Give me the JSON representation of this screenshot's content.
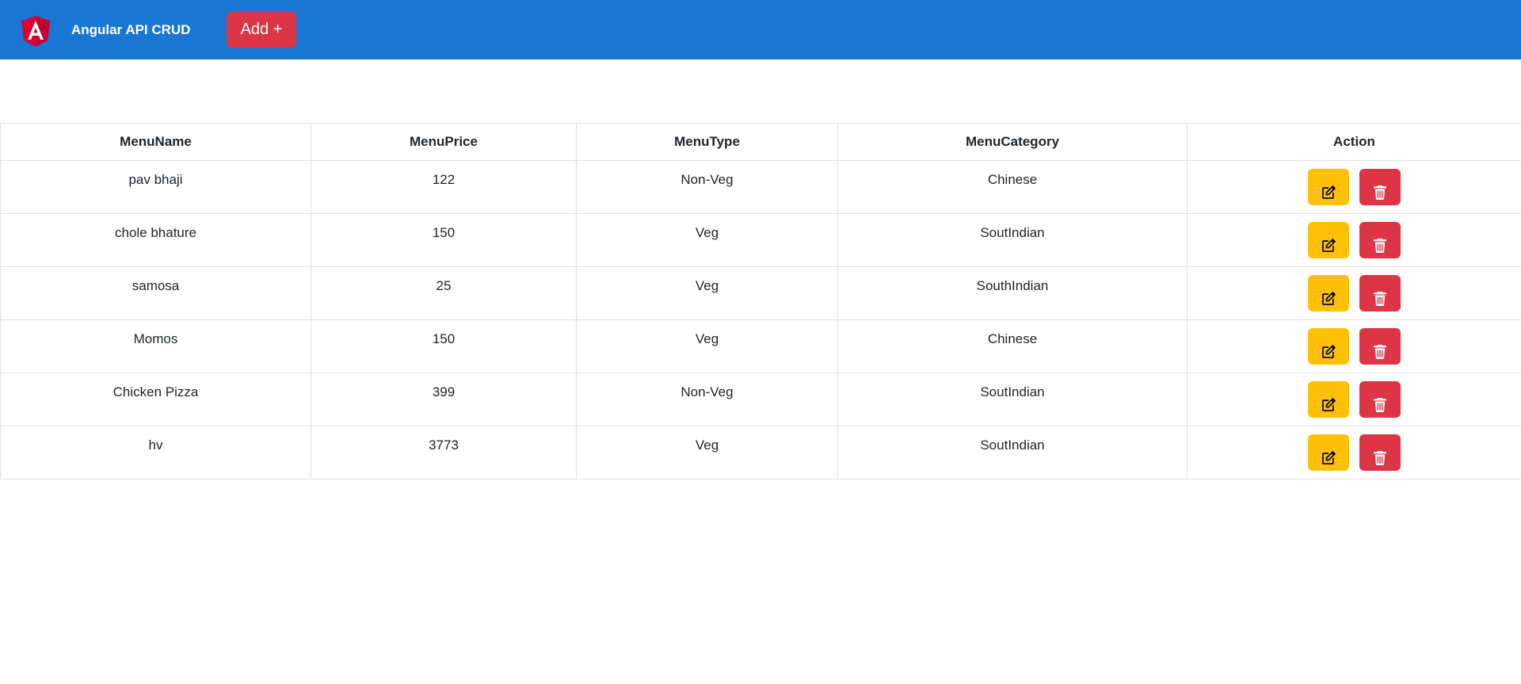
{
  "header": {
    "title": "Angular API CRUD",
    "add_label": "Add +",
    "logo_icon": "angular-logo-icon"
  },
  "table": {
    "columns": [
      "MenuName",
      "MenuPrice",
      "MenuType",
      "MenuCategory",
      "Action"
    ],
    "rows": [
      {
        "name": "pav bhaji",
        "price": "122",
        "type": "Non-Veg",
        "category": "Chinese"
      },
      {
        "name": "chole bhature",
        "price": "150",
        "type": "Veg",
        "category": "SoutIndian"
      },
      {
        "name": "samosa",
        "price": "25",
        "type": "Veg",
        "category": "SouthIndian"
      },
      {
        "name": "Momos",
        "price": "150",
        "type": "Veg",
        "category": "Chinese"
      },
      {
        "name": "Chicken Pizza",
        "price": "399",
        "type": "Non-Veg",
        "category": "SoutIndian"
      },
      {
        "name": "hv",
        "price": "3773",
        "type": "Veg",
        "category": "SoutIndian"
      }
    ],
    "action_icons": [
      "edit-icon",
      "trash-icon"
    ]
  },
  "colors": {
    "toolbar": "#1976d2",
    "add_button": "#dc3545",
    "edit_button": "#ffc107",
    "delete_button": "#dc3545"
  }
}
